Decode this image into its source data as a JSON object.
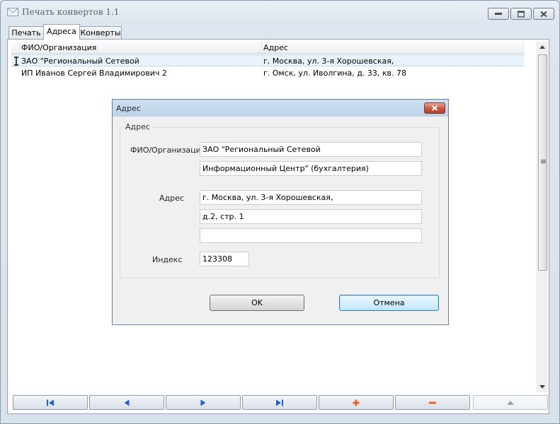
{
  "window": {
    "title": "Печать конвертов 1.1"
  },
  "tabs": [
    {
      "label": "Печать",
      "active": false
    },
    {
      "label": "Адреса",
      "active": true
    },
    {
      "label": "Конверты",
      "active": false
    }
  ],
  "grid": {
    "columns": [
      "ФИО/Организация",
      "Адрес"
    ],
    "rows": [
      {
        "name": "ЗАО \"Региональный Сетевой",
        "address": "г. Москва, ул. 3-я Хорошевская,",
        "selected": true
      },
      {
        "name": "ИП Иванов Сергей Владимирович 2",
        "address": "г. Омск, ул. Иволгина, д. 33, кв. 78",
        "selected": false
      }
    ]
  },
  "dialog": {
    "title": "Адрес",
    "group_label": "Адрес",
    "name_label": "ФИО/Организация",
    "name_line1": "ЗАО \"Региональный Сетевой",
    "name_line2": "Информационный Центр\" (бухгалтерия)",
    "address_label": "Адрес",
    "address_line1": "г. Москва, ул. 3-я Хорошевская,",
    "address_line2": "д.2, стр. 1",
    "address_line3": "",
    "index_label": "Индекс",
    "index_value": "123308",
    "ok_label": "OK",
    "cancel_label": "Отмена"
  },
  "navigator": {
    "buttons": [
      "first-icon",
      "prior-icon",
      "next-icon",
      "last-icon",
      "plus-icon",
      "minus-icon",
      "up-icon"
    ]
  },
  "colors": {
    "nav_arrows": "#1f5fcf",
    "nav_edit": "#e06a2a",
    "close_button": "#c95a45",
    "selection": "#eaf3fb"
  }
}
